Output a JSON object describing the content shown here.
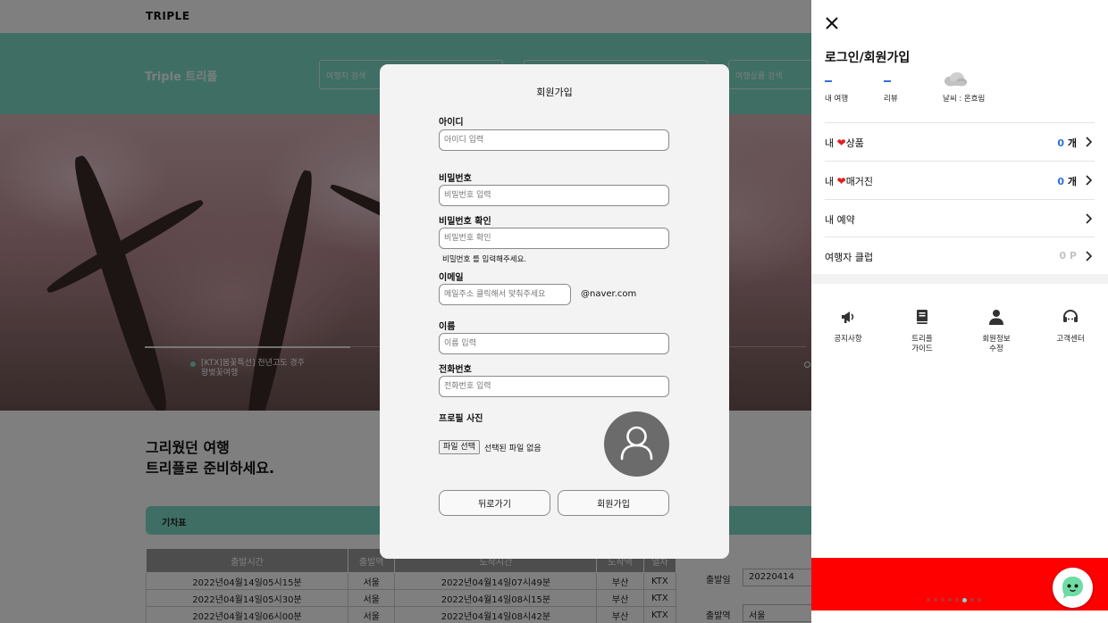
{
  "background": {
    "brand": "TRIPLE",
    "teal_title": "Triple 트리플",
    "search_fields": [
      "여행지 검색",
      "",
      "여행상품 검색"
    ],
    "hero_caption": [
      "[KTX]봄꽃특선] 천년고도 경주",
      "왕벚꽃여행"
    ],
    "tagline": [
      "그리웠던 여행",
      "트리플로 준비하세요."
    ],
    "train_bar_label": "기차표",
    "timetable": {
      "headers": [
        "출발시간",
        "출발역",
        "도착시간",
        "도착역",
        "열차"
      ],
      "rows": [
        [
          "2022년04월14일05시15분",
          "서울",
          "2022년04월14일07시49분",
          "부산",
          "KTX"
        ],
        [
          "2022년04월14일05시30분",
          "서울",
          "2022년04월14일08시15분",
          "부산",
          "KTX"
        ],
        [
          "2022년04월14일06시00분",
          "서울",
          "2022년04월14일08시42분",
          "부산",
          "KTX"
        ]
      ]
    },
    "side_form": {
      "date_label": "출발일",
      "date_value": "20220414",
      "station_label": "출발역",
      "station_value": "서울"
    }
  },
  "modal": {
    "title": "회원가입",
    "id_label": "아이디",
    "id_placeholder": "아이디 입력",
    "pw_label": "비밀번호",
    "pw_placeholder": "비밀번호 입력",
    "pw_confirm_label": "비밀번호 확인",
    "pw_confirm_placeholder": "비밀번호 확인",
    "pw_hint": "비밀번호 를 입력해주세요.",
    "email_label": "이메일",
    "email_placeholder": "메일주소 클릭해서 맞춰주세요",
    "email_domain": "@naver.com",
    "name_label": "이름",
    "name_placeholder": "이름 입력",
    "phone_label": "전화번호",
    "phone_placeholder": "전화번호 입력",
    "photo_label": "프로필 사진",
    "file_button": "파일 선택",
    "file_status": "선택된 파일 없음",
    "back_button": "뒤로가기",
    "submit_button": "회원가입"
  },
  "drawer": {
    "title": "로그인/회원가입",
    "stats": [
      {
        "value": "-",
        "label": "내 여행"
      },
      {
        "value": "-",
        "label": "리뷰"
      }
    ],
    "weather_label": "날씨 : 온흐림",
    "menu": [
      {
        "prefix": "내 ",
        "heart": "❤",
        "label": "상품",
        "count": "0",
        "unit": " 개"
      },
      {
        "prefix": "내 ",
        "heart": "❤",
        "label": "매거진",
        "count": "0",
        "unit": " 개"
      },
      {
        "prefix": "",
        "heart": "",
        "label": "내 예약",
        "count": "",
        "unit": ""
      },
      {
        "prefix": "",
        "heart": "",
        "label": "여행자 클럽",
        "count": "0 P",
        "unit": ""
      }
    ],
    "quick_links": [
      {
        "icon": "megaphone-icon",
        "lines": [
          "공지사항"
        ]
      },
      {
        "icon": "book-icon",
        "lines": [
          "트리플",
          "가이드"
        ]
      },
      {
        "icon": "user-icon",
        "lines": [
          "회원정보",
          "수정"
        ]
      },
      {
        "icon": "headset-icon",
        "lines": [
          "고객센터"
        ]
      }
    ],
    "banner_color": "#ff0000",
    "accent_blue": "#2f6fd8",
    "accent_teal": "#7fdcc9"
  }
}
